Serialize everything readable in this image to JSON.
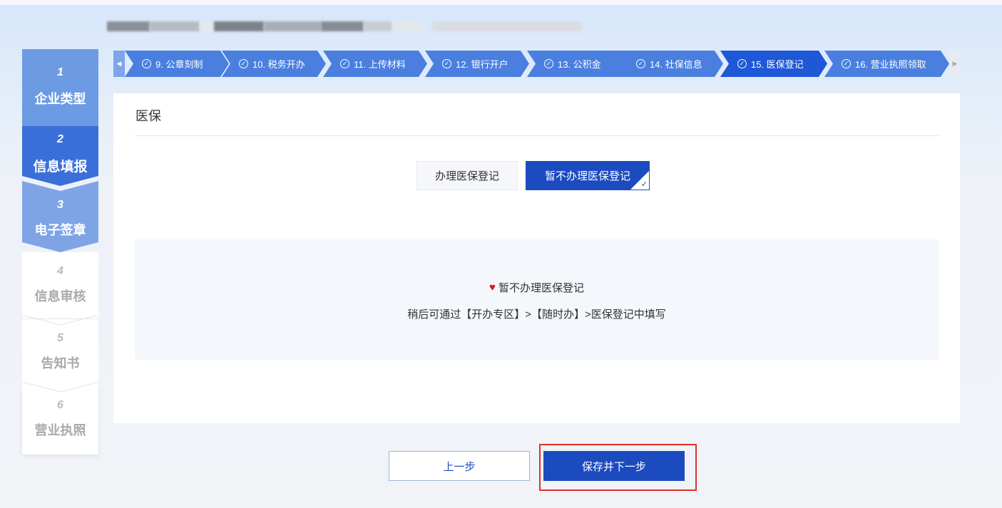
{
  "vertical_steps": [
    {
      "num": "1",
      "label": "企业类型"
    },
    {
      "num": "2",
      "label": "信息填报"
    },
    {
      "num": "3",
      "label": "电子签章"
    },
    {
      "num": "4",
      "label": "信息审核"
    },
    {
      "num": "5",
      "label": "告知书"
    },
    {
      "num": "6",
      "label": "营业执照"
    }
  ],
  "progress_steps": [
    {
      "label": "9. 公章刻制"
    },
    {
      "label": "10. 税务开办"
    },
    {
      "label": "11. 上传材料"
    },
    {
      "label": "12. 银行开户"
    },
    {
      "label": "13. 公积金"
    },
    {
      "label": "14. 社保信息"
    },
    {
      "label": "15. 医保登记"
    },
    {
      "label": "16. 营业执照领取"
    }
  ],
  "arrows": {
    "left": "◀",
    "right": "▶"
  },
  "card": {
    "title": "医保",
    "options": [
      "办理医保登记",
      "暂不办理医保登记"
    ],
    "notice_title": "暂不办理医保登记",
    "notice_heart": "♥",
    "notice_text": "稍后可通过【开办专区】>【随时办】>医保登记中填写"
  },
  "buttons": {
    "prev": "上一步",
    "next": "保存并下一步"
  },
  "check_glyph": "✓",
  "colors": {
    "primary": "#1c4bc0",
    "active_step": "#1f58d6",
    "highlight": "#e03030",
    "heart": "#d9141c"
  }
}
